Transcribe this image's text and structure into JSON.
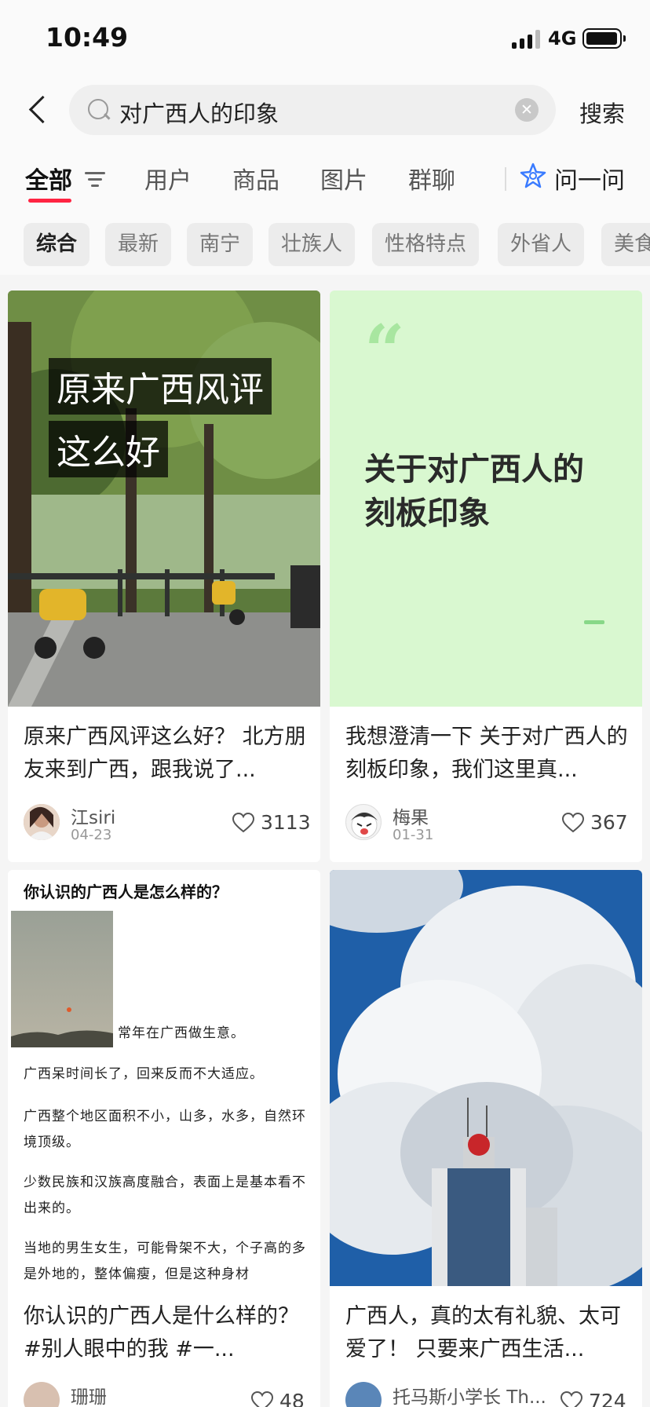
{
  "status": {
    "time": "10:49",
    "network": "4G"
  },
  "search": {
    "query": "对广西人的印象",
    "submit_label": "搜索"
  },
  "tabs": [
    {
      "label": "全部"
    },
    {
      "label": "用户"
    },
    {
      "label": "商品"
    },
    {
      "label": "图片"
    },
    {
      "label": "群聊"
    }
  ],
  "ask": {
    "label": "问一问"
  },
  "chips": [
    "综合",
    "最新",
    "南宁",
    "壮族人",
    "性格特点",
    "外省人",
    "美食"
  ],
  "cards": [
    {
      "image_caption_1": "原来广西风评",
      "image_caption_2": "这么好",
      "title": "原来广西风评这么好？ 北方朋友来到广西，跟我说了...",
      "author": "江siri",
      "date": "04-23",
      "likes": "3113"
    },
    {
      "quote_mark": "“",
      "quote_line_1": "关于对广西人的",
      "quote_line_2": "刻板印象",
      "title": "我想澄清一下 关于对广西人的刻板印象，我们这里真...",
      "author": "梅果",
      "date": "01-31",
      "likes": "367"
    },
    {
      "article_heading": "你认识的广西人是怎么样的？",
      "article_paragraphs": [
        "常年在广西做生意。",
        "广西呆时间长了，回来反而不大适应。",
        "广西整个地区面积不小，山多，水多，自然环境顶级。",
        "少数民族和汉族高度融合，表面上是基本看不出来的。",
        "当地的男生女生，可能骨架不大，个子高的多是外地的，整体偏瘦，但是这种身材"
      ],
      "title": "你认识的广西人是什么样的？ #别人眼中的我 #一...",
      "author": "珊珊",
      "likes": "48"
    },
    {
      "title": "广西人，真的太有礼貌、太可爱了！ 只要来广西生活...",
      "author": "托马斯小学长 Th...",
      "likes": "724"
    }
  ],
  "colors": {
    "accent": "#ff2442",
    "quote_bg": "#d9f8d0"
  }
}
